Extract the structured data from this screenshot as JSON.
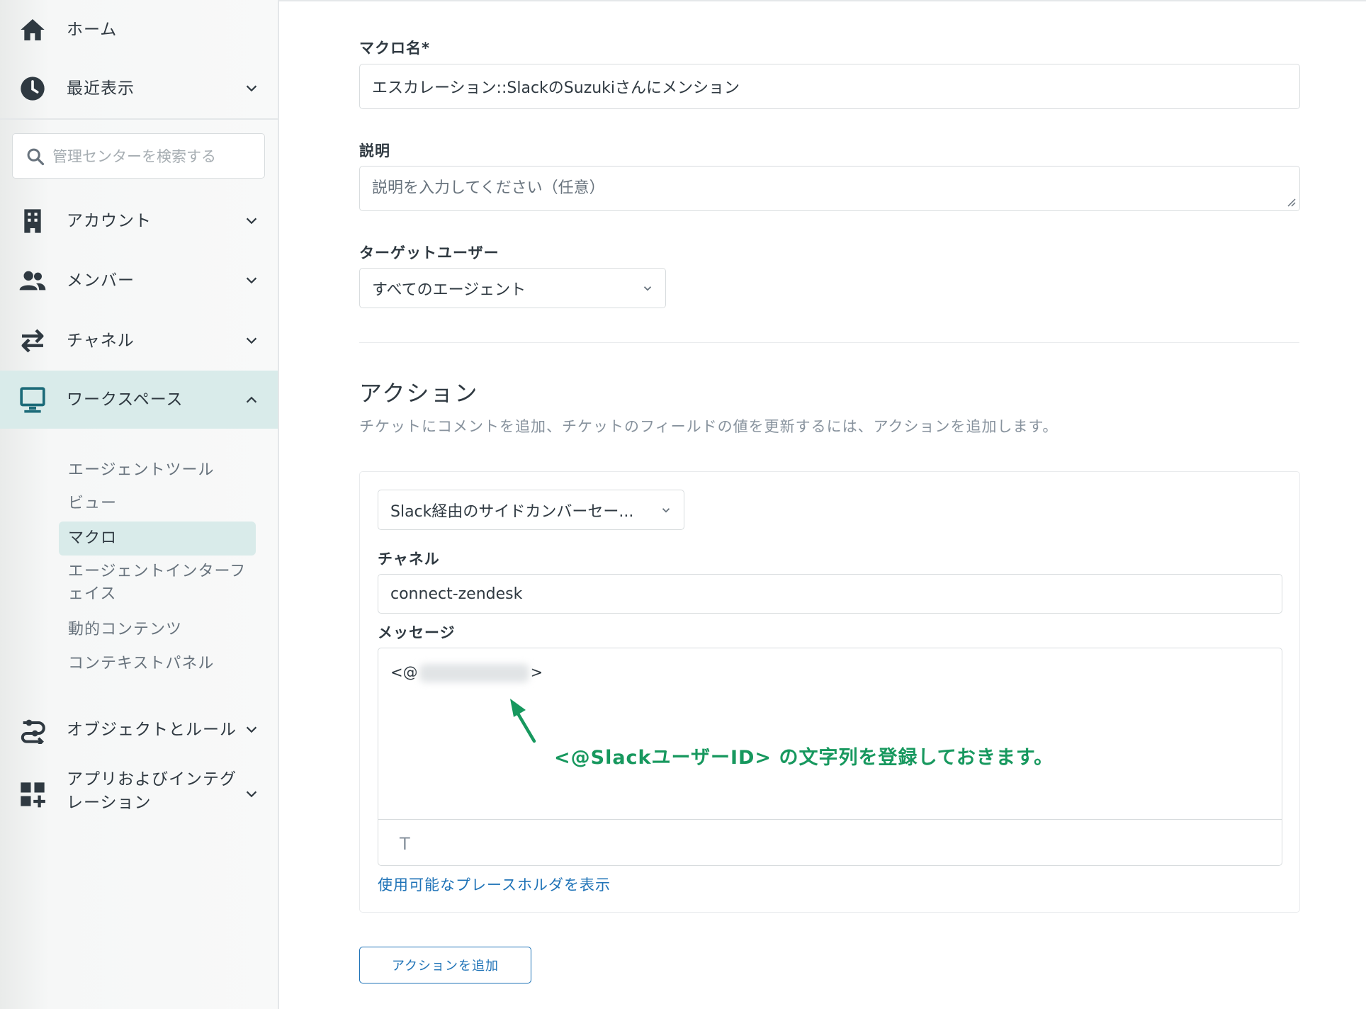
{
  "sidebar": {
    "home": "ホーム",
    "recent": "最近表示",
    "search_placeholder": "管理センターを検索する",
    "account": "アカウント",
    "members": "メンバー",
    "channels": "チャネル",
    "workspace": "ワークスペース",
    "workspace_items": [
      "エージェントツール",
      "ビュー",
      "マクロ",
      "エージェントインターフ",
      "ェイス",
      "動的コンテンツ",
      "コンテキストパネル"
    ],
    "objects_rules": "オブジェクトとルール",
    "apps_line1": "アプリおよびインテグ",
    "apps_line2": "レーション"
  },
  "form": {
    "macro_name_label": "マクロ名*",
    "macro_name_value": "エスカレーション::SlackのSuzukiさんにメンション",
    "description_label": "説明",
    "description_placeholder": "説明を入力してください（任意）",
    "target_label": "ターゲットユーザー",
    "target_value": "すべてのエージェント"
  },
  "actions": {
    "title": "アクション",
    "description": "チケットにコメントを追加、チケットのフィールドの値を更新するには、アクションを追加します。",
    "action_type": "Slack経由のサイドカンバーセー...",
    "channel_label": "チャネル",
    "channel_value": "connect-zendesk",
    "message_label": "メッセージ",
    "message_prefix": "<@",
    "message_suffix": ">",
    "format_symbol": "T",
    "annotation": "<@SlackユーザーID> の文字列を登録しておきます。",
    "placeholder_link": "使用可能なプレースホルダを表示",
    "add_button": "アクションを追加"
  },
  "colors": {
    "accent": "#1f73b7",
    "annotation": "#17985e",
    "active_bg": "#d9ebea"
  }
}
